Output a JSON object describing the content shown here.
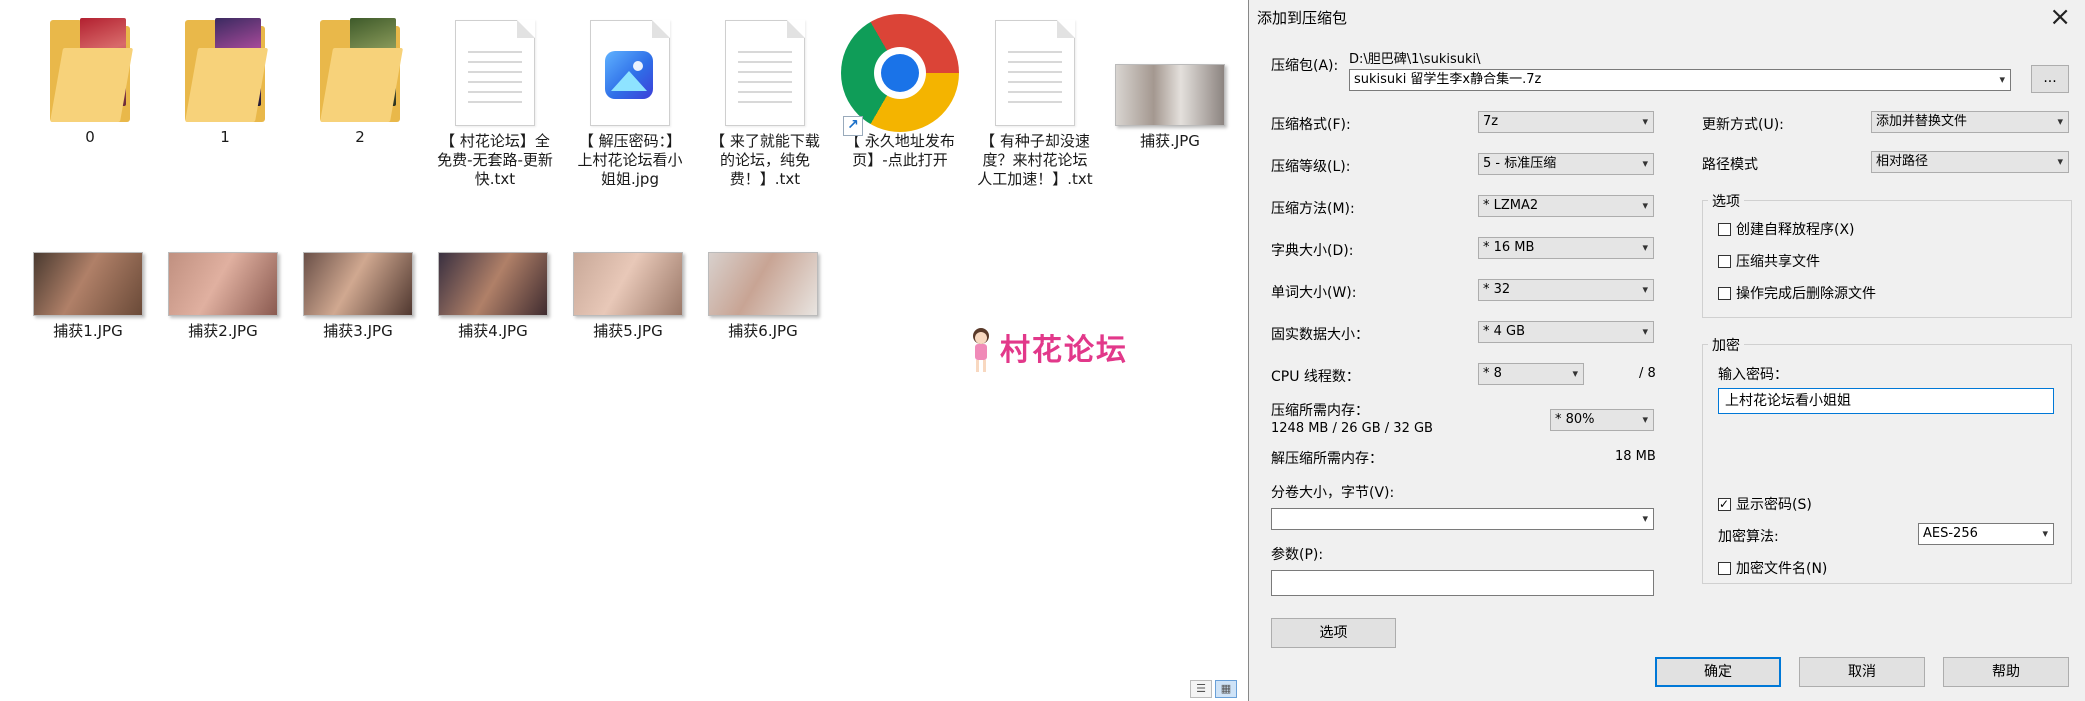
{
  "explorer": {
    "folders": [
      {
        "label": "0"
      },
      {
        "label": "1"
      },
      {
        "label": "2"
      }
    ],
    "files": [
      {
        "label": "【 村花论坛】全免费-无套路-更新快.txt",
        "icon": "text-file-icon"
      },
      {
        "label": "【 解压密码：】上村花论坛看小姐姐.jpg",
        "icon": "image-file-icon"
      },
      {
        "label": "【 来了就能下载的论坛，纯免费！】.txt",
        "icon": "text-file-icon"
      },
      {
        "label": "【 永久地址发布页】-点此打开",
        "icon": "chrome-shortcut-icon"
      },
      {
        "label": "【 有种子却没速度？来村花论坛人工加速！】.txt",
        "icon": "text-file-icon"
      },
      {
        "label": "捕获.JPG",
        "icon": "photo-thumbnail"
      }
    ],
    "images": [
      {
        "label": "捕获1.JPG"
      },
      {
        "label": "捕获2.JPG"
      },
      {
        "label": "捕获3.JPG"
      },
      {
        "label": "捕获4.JPG"
      },
      {
        "label": "捕获5.JPG"
      },
      {
        "label": "捕获6.JPG"
      }
    ],
    "watermark": "村花论坛"
  },
  "dialog": {
    "title": "添加到压缩包",
    "archive_label": "压缩包(A):",
    "archive_path": "D:\\胆巴碑\\1\\sukisuki\\",
    "archive_name": "sukisuki 留学生李x静合集一.7z",
    "browse_button": "...",
    "left": {
      "format_label": "压缩格式(F):",
      "format_value": "7z",
      "level_label": "压缩等级(L):",
      "level_value": "5 - 标准压缩",
      "method_label": "压缩方法(M):",
      "method_value": "* LZMA2",
      "dict_label": "字典大小(D):",
      "dict_value": "* 16 MB",
      "word_label": "单词大小(W):",
      "word_value": "* 32",
      "solid_label": "固实数据大小：",
      "solid_value": "* 4 GB",
      "cpu_label": "CPU 线程数：",
      "cpu_value": "* 8",
      "cpu_max": "/ 8",
      "mem_label": "压缩所需内存：",
      "mem_detail": "1248 MB / 26 GB / 32 GB",
      "mem_value": "* 80%",
      "decomp_label": "解压缩所需内存：",
      "decomp_value": "18 MB",
      "split_label": "分卷大小，字节(V):",
      "split_value": "",
      "params_label": "参数(P):",
      "params_value": "",
      "options_button": "选项"
    },
    "right": {
      "update_label": "更新方式(U):",
      "update_value": "添加并替换文件",
      "path_label": "路径模式",
      "path_value": "相对路径",
      "options_group": "选项",
      "opt_sfx": "创建自释放程序(X)",
      "opt_shared": "压缩共享文件",
      "opt_delete": "操作完成后删除源文件",
      "encrypt_group": "加密",
      "password_label": "输入密码：",
      "password_value": "上村花论坛看小姐姐",
      "show_password": "显示密码(S)",
      "algo_label": "加密算法:",
      "algo_value": "AES-256",
      "encrypt_names": "加密文件名(N)"
    },
    "checks": {
      "opt_sfx": false,
      "opt_shared": false,
      "opt_delete": false,
      "show_password": true,
      "encrypt_names": false
    },
    "buttons": {
      "ok": "确定",
      "cancel": "取消",
      "help": "帮助"
    }
  }
}
